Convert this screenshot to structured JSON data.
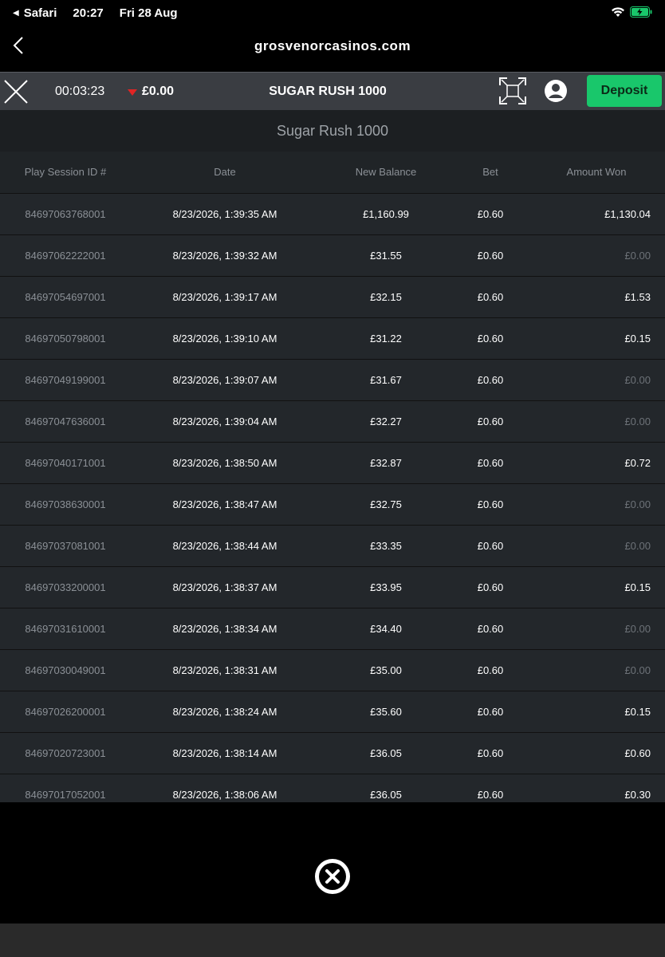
{
  "status_bar": {
    "back_app": "Safari",
    "time": "20:27",
    "date": "Fri 28 Aug"
  },
  "browser": {
    "domain": "grosvenorcasinos.com"
  },
  "toolbar": {
    "timer": "00:03:23",
    "balance": "£0.00",
    "game_title": "SUGAR RUSH 1000",
    "deposit_label": "Deposit"
  },
  "history": {
    "title": "Sugar Rush 1000",
    "columns": [
      "Play Session ID #",
      "Date",
      "New Balance",
      "Bet",
      "Amount Won"
    ],
    "rows": [
      [
        "84697063768001",
        "8/23/2026, 1:39:35 AM",
        "£1,160.99",
        "£0.60",
        "£1,130.04"
      ],
      [
        "84697062222001",
        "8/23/2026, 1:39:32 AM",
        "£31.55",
        "£0.60",
        "£0.00"
      ],
      [
        "84697054697001",
        "8/23/2026, 1:39:17 AM",
        "£32.15",
        "£0.60",
        "£1.53"
      ],
      [
        "84697050798001",
        "8/23/2026, 1:39:10 AM",
        "£31.22",
        "£0.60",
        "£0.15"
      ],
      [
        "84697049199001",
        "8/23/2026, 1:39:07 AM",
        "£31.67",
        "£0.60",
        "£0.00"
      ],
      [
        "84697047636001",
        "8/23/2026, 1:39:04 AM",
        "£32.27",
        "£0.60",
        "£0.00"
      ],
      [
        "84697040171001",
        "8/23/2026, 1:38:50 AM",
        "£32.87",
        "£0.60",
        "£0.72"
      ],
      [
        "84697038630001",
        "8/23/2026, 1:38:47 AM",
        "£32.75",
        "£0.60",
        "£0.00"
      ],
      [
        "84697037081001",
        "8/23/2026, 1:38:44 AM",
        "£33.35",
        "£0.60",
        "£0.00"
      ],
      [
        "84697033200001",
        "8/23/2026, 1:38:37 AM",
        "£33.95",
        "£0.60",
        "£0.15"
      ],
      [
        "84697031610001",
        "8/23/2026, 1:38:34 AM",
        "£34.40",
        "£0.60",
        "£0.00"
      ],
      [
        "84697030049001",
        "8/23/2026, 1:38:31 AM",
        "£35.00",
        "£0.60",
        "£0.00"
      ],
      [
        "84697026200001",
        "8/23/2026, 1:38:24 AM",
        "£35.60",
        "£0.60",
        "£0.15"
      ],
      [
        "84697020723001",
        "8/23/2026, 1:38:14 AM",
        "£36.05",
        "£0.60",
        "£0.60"
      ],
      [
        "84697017052001",
        "8/23/2026, 1:38:06 AM",
        "£36.05",
        "£0.60",
        "£0.30"
      ]
    ]
  },
  "colors": {
    "deposit_green": "#19c76b",
    "loss_indicator_red": "#e02424",
    "panel_bg": "#23272b"
  },
  "icons": {
    "status_wifi": "wifi-icon",
    "status_battery": "battery-charging-icon",
    "back": "chevron-left-icon",
    "close_game": "close-icon",
    "fullscreen": "fullscreen-icon",
    "account": "account-icon",
    "close_history": "close-circle-icon"
  }
}
